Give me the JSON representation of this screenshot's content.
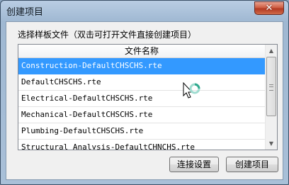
{
  "window": {
    "title": "创建项目",
    "close_glyph": "✕"
  },
  "instruction": "选择样板文件（双击可打开文件直接创建项目）",
  "list": {
    "column_header": "文件名称",
    "items": [
      {
        "name": "Construction-DefaultCHSCHS.rte",
        "selected": true
      },
      {
        "name": "DefaultCHSCHS.rte",
        "selected": false
      },
      {
        "name": "Electrical-DefaultCHSCHS.rte",
        "selected": false
      },
      {
        "name": "Mechanical-DefaultCHSCHS.rte",
        "selected": false
      },
      {
        "name": "Plumbing-DefaultCHSCHS.rte",
        "selected": false
      },
      {
        "name": "Structural Analysis-DefaultCHNCHS.rte",
        "selected": false
      }
    ]
  },
  "buttons": {
    "connect_settings": "连接设置",
    "create_project": "创建项目"
  },
  "colors": {
    "selection": "#3399ff",
    "close_button": "#c8452b"
  },
  "icons": {
    "cursor": "busy-arrow-cursor-icon",
    "close": "close-icon"
  }
}
